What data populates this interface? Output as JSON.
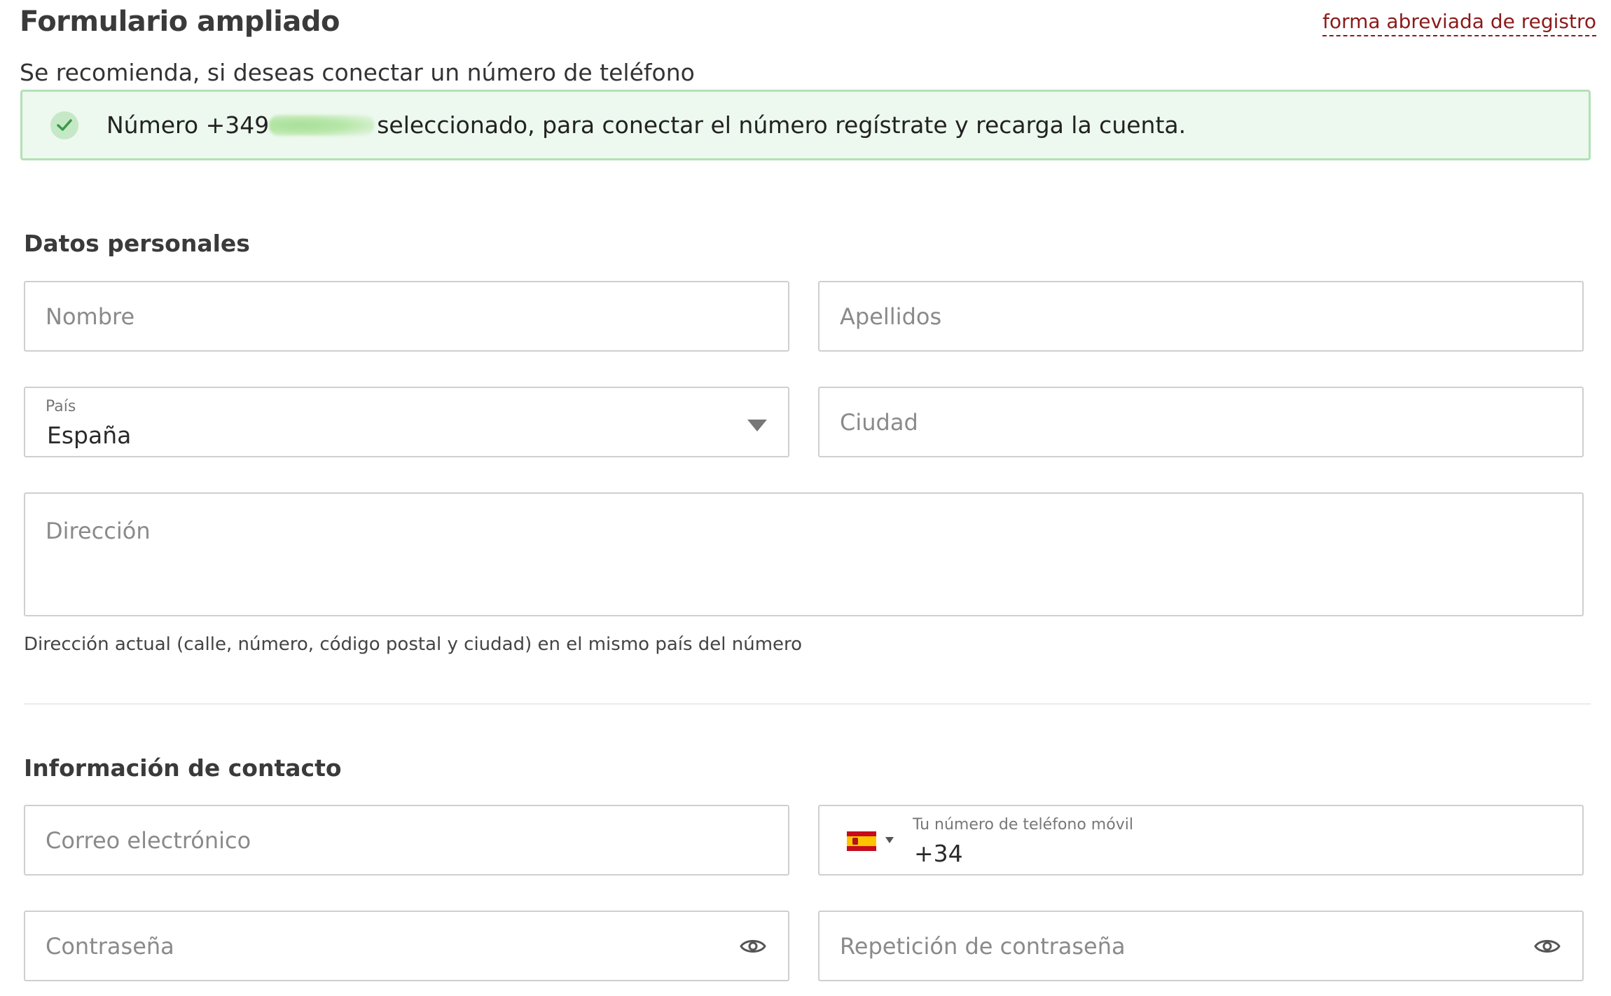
{
  "header": {
    "title": "Formulario ampliado",
    "short_form_link": "forma abreviada de registro"
  },
  "recommendation": "Se recomienda, si deseas conectar un número de teléfono",
  "notice": {
    "prefix": "Número +349",
    "suffix": "seleccionado, para conectar el número regístrate y recarga la cuenta.",
    "icon": "check-circle-icon",
    "color": "#edf8ee"
  },
  "personal": {
    "title": "Datos personales",
    "first_name_placeholder": "Nombre",
    "last_name_placeholder": "Apellidos",
    "country_label": "País",
    "country_value": "España",
    "city_placeholder": "Ciudad",
    "address_placeholder": "Dirección",
    "address_hint": "Dirección actual (calle, número, código postal y ciudad) en el mismo país del número"
  },
  "contact": {
    "title": "Información de contacto",
    "email_placeholder": "Correo electrónico",
    "phone_label": "Tu número de teléfono móvil",
    "phone_value": "+34",
    "phone_flag": "spain-flag-icon",
    "password_placeholder": "Contraseña",
    "password_repeat_placeholder": "Repetición de contraseña"
  },
  "colors": {
    "link": "#8b1a1a",
    "notice_border": "#b3e0b5",
    "check": "#3a9a47"
  }
}
